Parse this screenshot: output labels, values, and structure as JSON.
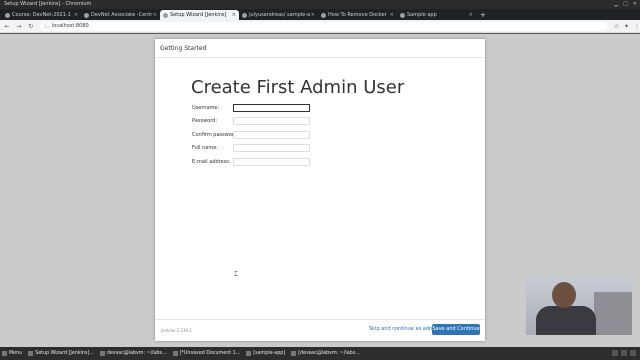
{
  "window": {
    "title": "Setup Wizard [Jenkins] - Chromium"
  },
  "tabs": [
    {
      "label": "Course: DevNet-2021-1",
      "active": false
    },
    {
      "label": "DevNet Associate -Centr",
      "active": false
    },
    {
      "label": "Setup Wizard [Jenkins]",
      "active": true
    },
    {
      "label": "julyusandreas/ sample-a",
      "active": false
    },
    {
      "label": "How To Remove Docker",
      "active": false
    },
    {
      "label": "Sample app",
      "active": false
    }
  ],
  "address_bar": {
    "url": "localhost:8080"
  },
  "dialog": {
    "header": "Getting Started",
    "heading": "Create First Admin User",
    "fields": [
      {
        "label": "Username:",
        "value": "",
        "focused": true
      },
      {
        "label": "Password:",
        "value": ""
      },
      {
        "label": "Confirm password:",
        "value": ""
      },
      {
        "label": "Full name:",
        "value": ""
      },
      {
        "label": "E-mail address:",
        "value": ""
      }
    ],
    "footer": {
      "version": "Jenkins 2.319.1",
      "skip_label": "Skip and continue as admin",
      "save_label": "Save and Continue"
    }
  },
  "taskbar": {
    "items": [
      {
        "label": "Menu"
      },
      {
        "label": "Setup Wizard [Jenkins]..."
      },
      {
        "label": "devasc@labvm: ~/labs..."
      },
      {
        "label": "[*Unsaved Document 1..."
      },
      {
        "label": "[sample-app]"
      },
      {
        "label": "[devasc@labvm: ~/labs..."
      }
    ]
  },
  "colors": {
    "accent": "#2f75b5",
    "link": "#2a6ebb"
  }
}
